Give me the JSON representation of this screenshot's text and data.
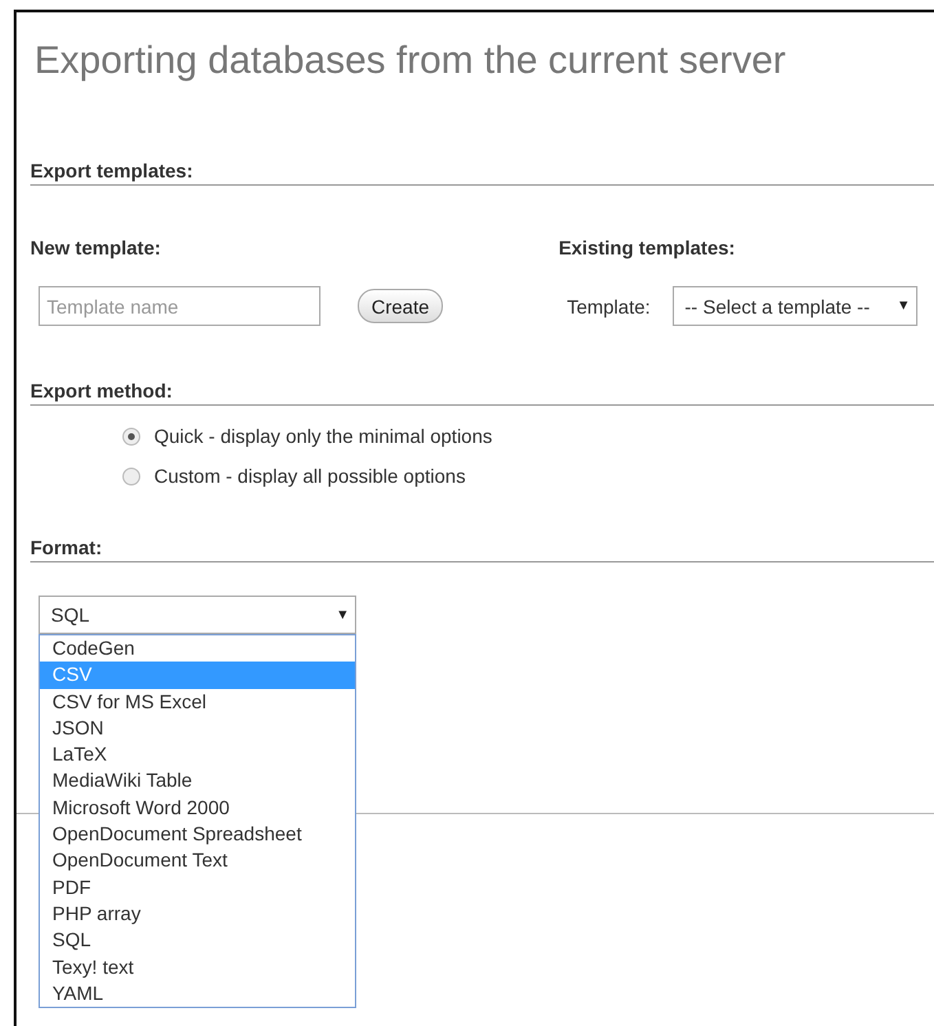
{
  "title": "Exporting databases from the current server",
  "export_templates": {
    "heading": "Export templates:",
    "new_template": {
      "heading": "New template:",
      "placeholder": "Template name",
      "button": "Create"
    },
    "existing_templates": {
      "heading": "Existing templates:",
      "label": "Template:",
      "select": "-- Select a template --",
      "arrow": "▼"
    }
  },
  "export_method": {
    "heading": "Export method:",
    "options": [
      {
        "label": "Quick - display only the minimal options",
        "selected": true
      },
      {
        "label": "Custom - display all possible options",
        "selected": false
      }
    ]
  },
  "format": {
    "heading": "Format:",
    "select": "SQL",
    "arrow": "▼",
    "options": [
      {
        "label": "CodeGen",
        "selected": false
      },
      {
        "label": "CSV",
        "selected": true
      },
      {
        "label": "CSV for MS Excel",
        "selected": false
      },
      {
        "label": "JSON",
        "selected": false
      },
      {
        "label": "LaTeX",
        "selected": false
      },
      {
        "label": "MediaWiki Table",
        "selected": false
      },
      {
        "label": "Microsoft Word 2000",
        "selected": false
      },
      {
        "label": "OpenDocument Spreadsheet",
        "selected": false
      },
      {
        "label": "OpenDocument Text",
        "selected": false
      },
      {
        "label": "PDF",
        "selected": false
      },
      {
        "label": "PHP array",
        "selected": false
      },
      {
        "label": "SQL",
        "selected": false
      },
      {
        "label": "Texy! text",
        "selected": false
      },
      {
        "label": "YAML",
        "selected": false
      }
    ]
  }
}
